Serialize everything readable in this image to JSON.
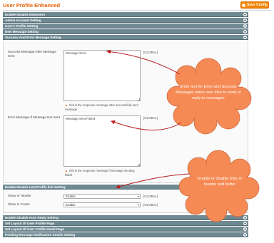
{
  "header": {
    "title": "User Profile Enhanced",
    "save_label": "Save Config"
  },
  "sections_top": [
    {
      "label": "Enable Disable Extension",
      "state": "collapsed"
    },
    {
      "label": "Admin Account Setting",
      "state": "collapsed"
    },
    {
      "label": "User's Profile Setting",
      "state": "collapsed"
    },
    {
      "label": "New Message Setting",
      "state": "collapsed"
    },
    {
      "label": "Success And Error Message Setting",
      "state": "expanded"
    }
  ],
  "message_settings": {
    "success_label": "Success Message After Message Sent",
    "success_value": "Message Sent",
    "success_scope": "[GLOBAL]",
    "success_hint": "this is the response message after successfully sent message",
    "error_label": "Error Message If Message Not Sent",
    "error_value": "Message Sent Failed",
    "error_scope": "[GLOBAL]",
    "error_hint": "this is the response message if message sending failed"
  },
  "link_section": {
    "label": "Enable Disable UserProfile link Setting",
    "state": "expanded"
  },
  "link_settings": {
    "header_label": "Show in Header",
    "header_value": "Enable",
    "header_scope": "[GLOBAL]",
    "footer_label": "Show in Footer",
    "footer_value": "Enable",
    "footer_scope": "[GLOBAL]"
  },
  "sections_bottom": [
    {
      "label": "Enable Disable Auto Reply Setting",
      "state": "collapsed"
    },
    {
      "label": "Set Layout Of User Profile Page",
      "state": "collapsed"
    },
    {
      "label": "Set Layout Of User Profile Detail Page",
      "state": "collapsed"
    },
    {
      "label": "Pending Message Notification Emails Setting",
      "state": "collapsed"
    }
  ],
  "callouts": {
    "messages": "Enter text for Error and Success Messages when user tries to send or reply to messages",
    "links": "Enable or disable links in header and footer"
  },
  "colors": {
    "accent": "#eb5e00",
    "section_bar": "#6f8992",
    "callout_fill": "#f58a55",
    "callout_arrow": "#b81e1e"
  }
}
